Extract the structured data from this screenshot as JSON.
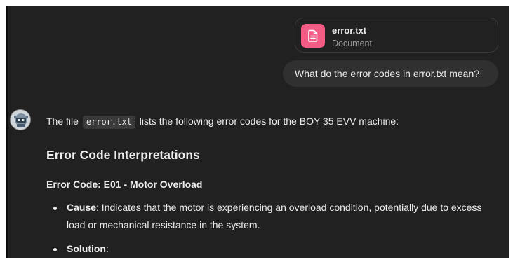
{
  "attachment": {
    "file_name": "error.txt",
    "file_type": "Document",
    "icon": "document-icon",
    "icon_color": "#f35d85"
  },
  "user_message": "What do the error codes in error.txt mean?",
  "assistant": {
    "avatar": "assistant-avatar",
    "intro_before": "The file",
    "intro_code": "error.txt",
    "intro_after": "lists the following error codes for the BOY 35 EVV machine:",
    "heading": "Error Code Interpretations",
    "subheading": "Error Code: E01 - Motor Overload",
    "items": [
      {
        "label": "Cause",
        "text": ": Indicates that the motor is experiencing an overload condition, potentially due to excess load or mechanical resistance in the system."
      },
      {
        "label": "Solution",
        "text": ":"
      }
    ]
  },
  "colors": {
    "background": "#212121",
    "bubble": "#303030",
    "text": "#ececec"
  }
}
